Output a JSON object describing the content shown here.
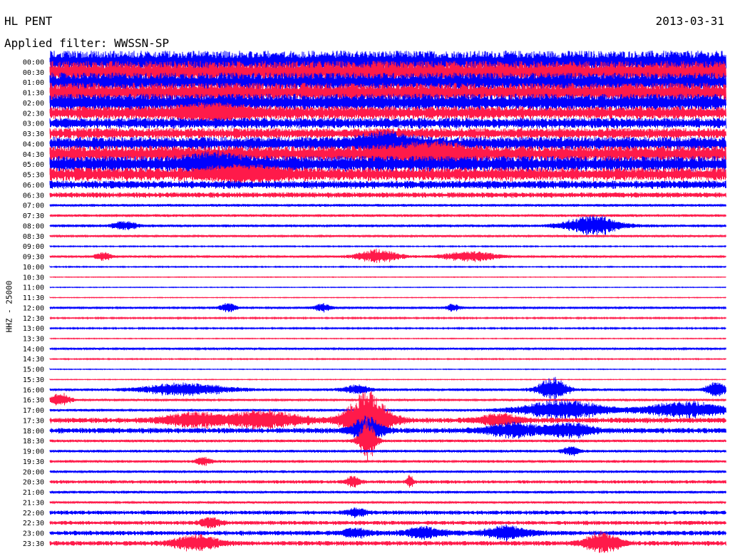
{
  "header": {
    "station": "HL PENT",
    "date": "2013-03-31",
    "filter": "Applied filter: WWSSN-SP"
  },
  "channel_label": "HHZ - 25000",
  "colors": {
    "trace_a": "#0000ff",
    "trace_b": "#ff1a4a"
  },
  "rows": [
    {
      "label": "00:00",
      "color": "trace_a",
      "noise": 16
    },
    {
      "label": "00:30",
      "color": "trace_b",
      "noise": 16
    },
    {
      "label": "01:00",
      "color": "trace_a",
      "noise": 14
    },
    {
      "label": "01:30",
      "color": "trace_b",
      "noise": 14
    },
    {
      "label": "02:00",
      "color": "trace_a",
      "noise": 13
    },
    {
      "label": "02:30",
      "color": "trace_b",
      "noise": 10
    },
    {
      "label": "03:00",
      "color": "trace_a",
      "noise": 8
    },
    {
      "label": "03:30",
      "color": "trace_b",
      "noise": 8
    },
    {
      "label": "04:00",
      "color": "trace_a",
      "noise": 10
    },
    {
      "label": "04:30",
      "color": "trace_b",
      "noise": 12
    },
    {
      "label": "05:00",
      "color": "trace_a",
      "noise": 12
    },
    {
      "label": "05:30",
      "color": "trace_b",
      "noise": 10
    },
    {
      "label": "06:00",
      "color": "trace_a",
      "noise": 6
    },
    {
      "label": "06:30",
      "color": "trace_b",
      "noise": 4
    },
    {
      "label": "07:00",
      "color": "trace_a",
      "noise": 2
    },
    {
      "label": "07:30",
      "color": "trace_b",
      "noise": 2
    },
    {
      "label": "08:00",
      "color": "trace_a",
      "noise": 2
    },
    {
      "label": "08:30",
      "color": "trace_b",
      "noise": 1.5
    },
    {
      "label": "09:00",
      "color": "trace_a",
      "noise": 0.8
    },
    {
      "label": "09:30",
      "color": "trace_b",
      "noise": 1.5
    },
    {
      "label": "10:00",
      "color": "trace_a",
      "noise": 0.8
    },
    {
      "label": "10:30",
      "color": "trace_b",
      "noise": 0.5
    },
    {
      "label": "11:00",
      "color": "trace_a",
      "noise": 0.5
    },
    {
      "label": "11:30",
      "color": "trace_b",
      "noise": 0.5
    },
    {
      "label": "12:00",
      "color": "trace_a",
      "noise": 1.5
    },
    {
      "label": "12:30",
      "color": "trace_b",
      "noise": 1
    },
    {
      "label": "13:00",
      "color": "trace_a",
      "noise": 1
    },
    {
      "label": "13:30",
      "color": "trace_b",
      "noise": 0.6
    },
    {
      "label": "14:00",
      "color": "trace_a",
      "noise": 1.5
    },
    {
      "label": "14:30",
      "color": "trace_b",
      "noise": 0.8
    },
    {
      "label": "15:00",
      "color": "trace_a",
      "noise": 0.5
    },
    {
      "label": "15:30",
      "color": "trace_b",
      "noise": 0.5
    },
    {
      "label": "16:00",
      "color": "trace_a",
      "noise": 2
    },
    {
      "label": "16:30",
      "color": "trace_b",
      "noise": 1.5
    },
    {
      "label": "17:00",
      "color": "trace_a",
      "noise": 2
    },
    {
      "label": "17:30",
      "color": "trace_b",
      "noise": 4
    },
    {
      "label": "18:00",
      "color": "trace_a",
      "noise": 4
    },
    {
      "label": "18:30",
      "color": "trace_b",
      "noise": 2
    },
    {
      "label": "19:00",
      "color": "trace_a",
      "noise": 2
    },
    {
      "label": "19:30",
      "color": "trace_b",
      "noise": 2
    },
    {
      "label": "20:00",
      "color": "trace_a",
      "noise": 2
    },
    {
      "label": "20:30",
      "color": "trace_b",
      "noise": 2.5
    },
    {
      "label": "21:00",
      "color": "trace_a",
      "noise": 2
    },
    {
      "label": "21:30",
      "color": "trace_b",
      "noise": 1.5
    },
    {
      "label": "22:00",
      "color": "trace_a",
      "noise": 3
    },
    {
      "label": "22:30",
      "color": "trace_b",
      "noise": 3
    },
    {
      "label": "23:00",
      "color": "trace_a",
      "noise": 3.5
    },
    {
      "label": "23:30",
      "color": "trace_b",
      "noise": 3.5
    }
  ]
}
